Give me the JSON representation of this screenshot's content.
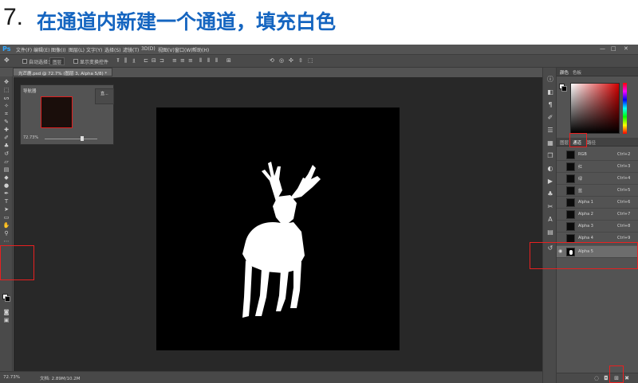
{
  "headline": {
    "step_number": "7.",
    "step_text": "在通道内新建一个通道，填充白色"
  },
  "app": {
    "logo": "Ps",
    "menu": [
      "文件(F)",
      "编辑(E)",
      "图像(I)",
      "图层(L)",
      "文字(Y)",
      "选择(S)",
      "滤镜(T)",
      "3D(D)",
      "视图(V)",
      "窗口(W)",
      "帮助(H)"
    ],
    "window_controls": [
      "—",
      "□",
      "✕"
    ]
  },
  "options_bar": {
    "auto_select_label": "自动选择：",
    "auto_select_value": "图层",
    "show_transform_label": "显示变换控件"
  },
  "document_tab": {
    "title": "光芒鹿.psd @ 72.7% (图层 3, Alpha 5/8) *"
  },
  "navigator": {
    "title": "导航器",
    "zoom": "72.73%",
    "side_label": "直..."
  },
  "status_bar": {
    "zoom": "72.73%",
    "doc_info": "文档: 2.89M/10.2M"
  },
  "right_panel": {
    "top_tabs": [
      "颜色",
      "色板"
    ],
    "mid_tabs": [
      "图层",
      "通道",
      "路径"
    ],
    "active_mid_tab": "通道",
    "channels": [
      {
        "name": "RGB",
        "shortcut": "Ctrl+2",
        "visible": true,
        "selected": false
      },
      {
        "name": "红",
        "shortcut": "Ctrl+3",
        "visible": true,
        "selected": false
      },
      {
        "name": "绿",
        "shortcut": "Ctrl+4",
        "visible": true,
        "selected": false
      },
      {
        "name": "蓝",
        "shortcut": "Ctrl+5",
        "visible": true,
        "selected": false
      },
      {
        "name": "Alpha 1",
        "shortcut": "Ctrl+6",
        "visible": false,
        "selected": false
      },
      {
        "name": "Alpha 2",
        "shortcut": "Ctrl+7",
        "visible": false,
        "selected": false
      },
      {
        "name": "Alpha 3",
        "shortcut": "Ctrl+8",
        "visible": false,
        "selected": false
      },
      {
        "name": "Alpha 4",
        "shortcut": "Ctrl+9",
        "visible": false,
        "selected": false
      },
      {
        "name": "Alpha 5",
        "shortcut": "",
        "visible": true,
        "selected": true
      }
    ]
  },
  "colors": {
    "foreground": "#ffffff",
    "background": "#000000",
    "highlight": "#e82020",
    "accent_blue": "#1565c0"
  }
}
